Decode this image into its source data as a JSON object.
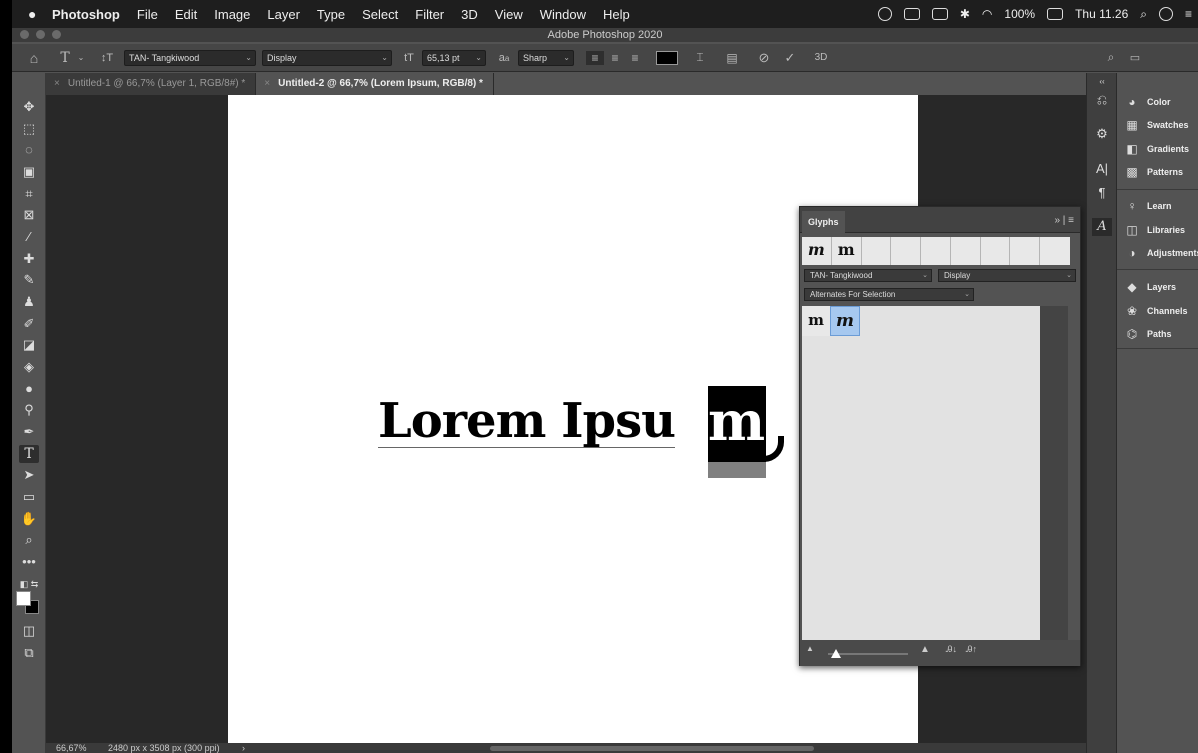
{
  "menubar": {
    "app": "Photoshop",
    "items": [
      "File",
      "Edit",
      "Image",
      "Layer",
      "Type",
      "Select",
      "Filter",
      "3D",
      "View",
      "Window",
      "Help"
    ],
    "battery": "100%",
    "clock": "Thu 11.26"
  },
  "window": {
    "title": "Adobe Photoshop 2020"
  },
  "options": {
    "font_family": "TAN- Tangkiwood",
    "font_style": "Display",
    "font_size": "65,13 pt",
    "antialias_symbol": "a",
    "antialias_symbol_small": "a",
    "antialias": "Sharp",
    "threed": "3D"
  },
  "tabs": [
    {
      "close": "×",
      "label": "Untitled-1 @ 66,7% (Layer 1, RGB/8#) *"
    },
    {
      "close": "×",
      "label": "Untitled-2 @ 66,7% (Lorem Ipsum, RGB/8) *"
    }
  ],
  "canvas": {
    "text_main": "Lorem Ipsu",
    "text_selected": "m"
  },
  "status": {
    "zoom": "66,67%",
    "doc_info": "2480 px x 3508 px (300 ppi)",
    "arrow": "›"
  },
  "panels": {
    "items": [
      "Color",
      "Swatches",
      "Gradients",
      "Patterns",
      "Learn",
      "Libraries",
      "Adjustments",
      "Layers",
      "Channels",
      "Paths"
    ]
  },
  "glyphs": {
    "title": "Glyphs",
    "recent": [
      "m",
      "m"
    ],
    "font_family": "TAN- Tangkiwood",
    "font_style": "Display",
    "filter": "Alternates For Selection",
    "alternates": [
      "m",
      "m"
    ]
  }
}
